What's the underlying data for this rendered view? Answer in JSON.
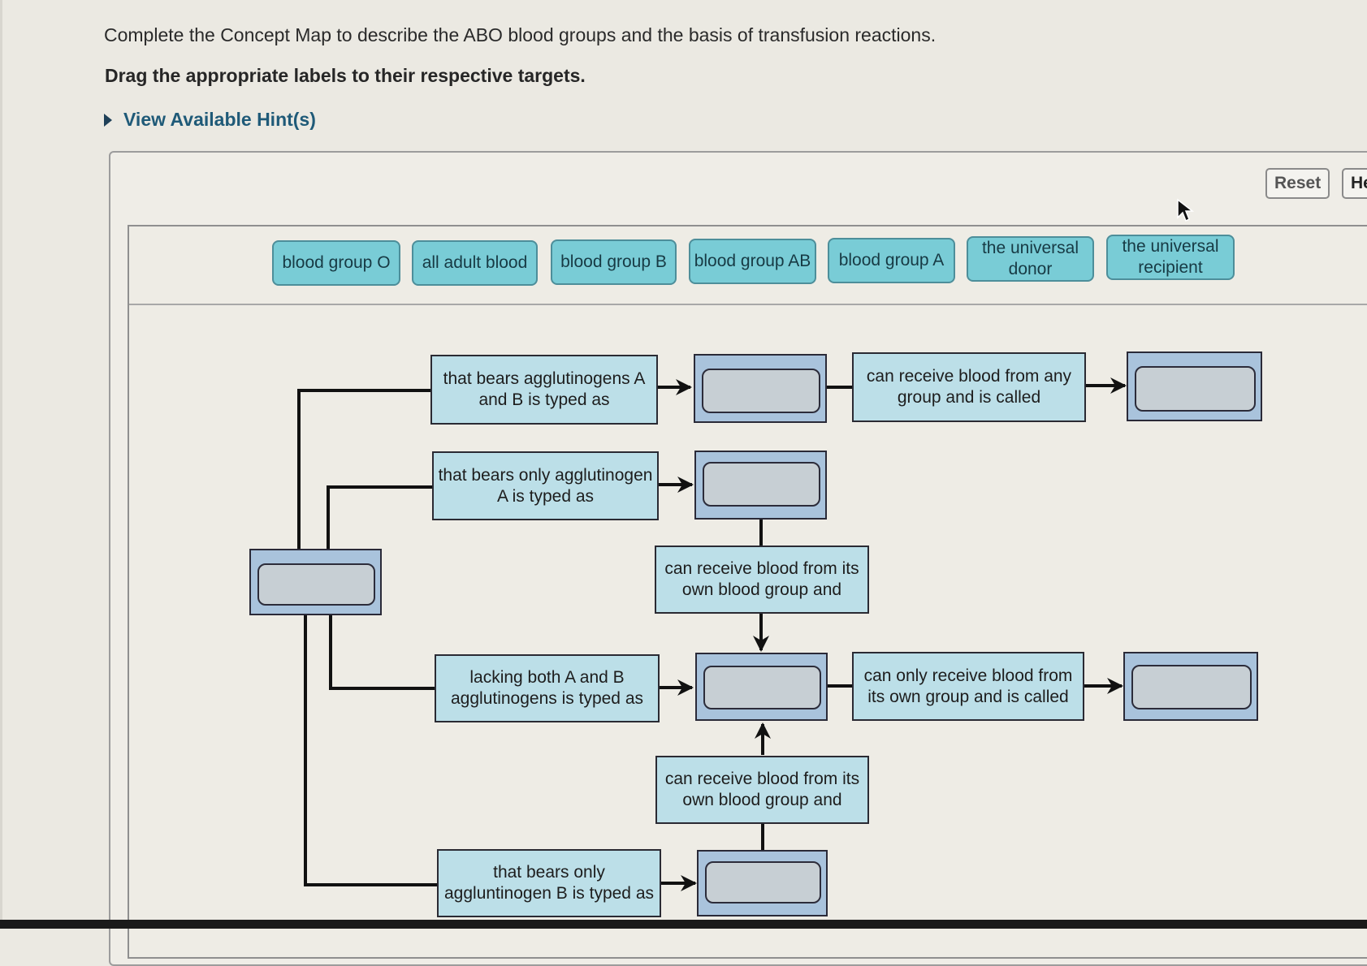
{
  "instructions": {
    "line1": "Complete the Concept Map to describe the ABO blood groups and the basis of transfusion reactions.",
    "line2": "Drag the appropriate labels to their respective targets.",
    "hint_link": "View Available Hint(s)"
  },
  "toolbar": {
    "reset_label": "Reset",
    "help_label": "Help"
  },
  "label_bank": [
    {
      "text": "blood group O"
    },
    {
      "text": "all adult blood"
    },
    {
      "text": "blood group B"
    },
    {
      "text": "blood group AB"
    },
    {
      "text": "blood group A"
    },
    {
      "text": "the universal donor"
    },
    {
      "text": "the universal recipient"
    }
  ],
  "concept_map": {
    "nodes": {
      "ab_typed": "that bears agglutinogens A and B is typed as",
      "a_typed": "that bears only agglutinogen A is typed as",
      "none_typed": "lacking both A and B agglutinogens is typed as",
      "b_typed": "that bears only aggluntinogen B is typed as",
      "receive_any": "can receive blood from any group and is called",
      "receive_own_1": "can receive blood from its own blood group and",
      "receive_only_own": "can only receive blood from its own group and is called",
      "receive_own_2": "can receive blood from its own blood group and"
    },
    "targets": [
      "root",
      "ab-group",
      "universal-recipient",
      "a-group",
      "o-group",
      "universal-donor",
      "b-group"
    ]
  },
  "colors": {
    "label_chip": "#79ccd6",
    "node_fill": "#bcdfe8",
    "target_fill": "#a9c3dc",
    "drop_zone": "#c7cfd4",
    "hint_link": "#1f5a78"
  }
}
